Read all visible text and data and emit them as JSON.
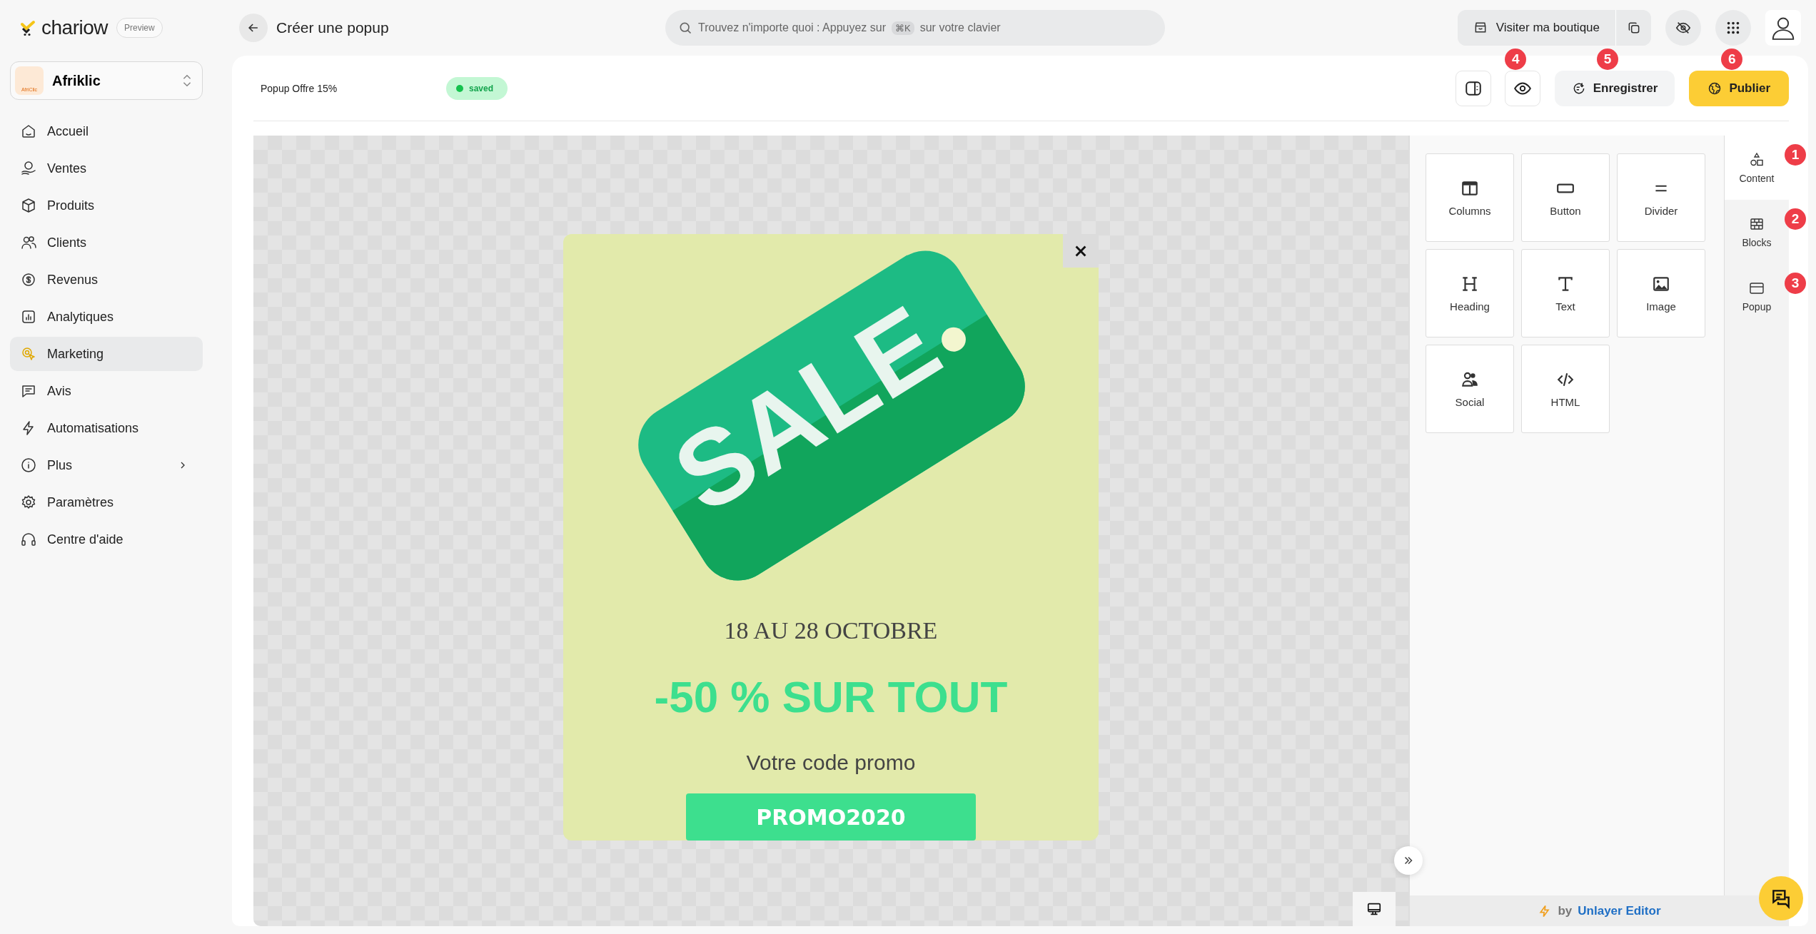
{
  "brand": {
    "name": "chariow",
    "badge": "Preview"
  },
  "store": {
    "name": "Afriklic",
    "logo_text": "AfriClic"
  },
  "nav": [
    {
      "label": "Accueil",
      "kind": "home",
      "selected": false,
      "expandable": false
    },
    {
      "label": "Ventes",
      "kind": "sales",
      "selected": false,
      "expandable": false
    },
    {
      "label": "Produits",
      "kind": "box",
      "selected": false,
      "expandable": false
    },
    {
      "label": "Clients",
      "kind": "users",
      "selected": false,
      "expandable": false
    },
    {
      "label": "Revenus",
      "kind": "revenue",
      "selected": false,
      "expandable": false
    },
    {
      "label": "Analytiques",
      "kind": "chart",
      "selected": false,
      "expandable": false
    },
    {
      "label": "Marketing",
      "kind": "marketing",
      "selected": true,
      "expandable": false
    },
    {
      "label": "Avis",
      "kind": "chat",
      "selected": false,
      "expandable": false
    },
    {
      "label": "Automatisations",
      "kind": "bolt",
      "selected": false,
      "expandable": false
    },
    {
      "label": "Plus",
      "kind": "info",
      "selected": false,
      "expandable": true
    },
    {
      "label": "Paramètres",
      "kind": "gear",
      "selected": false,
      "expandable": false
    },
    {
      "label": "Centre d'aide",
      "kind": "headset",
      "selected": false,
      "expandable": false
    }
  ],
  "topbar": {
    "title": "Créer une popup",
    "search": {
      "placeholder_before": "Trouvez n'importe quoi : Appuyez sur",
      "shortcut": "⌘K",
      "placeholder_after": "sur votre clavier"
    },
    "visit_button": "Visiter ma boutique"
  },
  "editor": {
    "name": "Popup Offre 15%",
    "status": {
      "label": "saved",
      "saved": true
    },
    "actions": [
      {
        "kind": "panel-toggle"
      },
      {
        "kind": "preview",
        "marker": "4"
      },
      {
        "kind": "save",
        "label": "Enregistrer",
        "marker": "5"
      },
      {
        "kind": "publish",
        "label": "Publier",
        "marker": "6"
      }
    ]
  },
  "popup": {
    "tag_text": "SALE",
    "date": "18 AU 28 OCTOBRE",
    "headline": "-50 % SUR TOUT",
    "subtitle": "Votre code promo",
    "code": "PROMO2020"
  },
  "tools": [
    {
      "label": "Columns",
      "kind": "columns"
    },
    {
      "label": "Button",
      "kind": "button"
    },
    {
      "label": "Divider",
      "kind": "divider"
    },
    {
      "label": "Heading",
      "kind": "heading"
    },
    {
      "label": "Text",
      "kind": "text"
    },
    {
      "label": "Image",
      "kind": "image"
    },
    {
      "label": "Social",
      "kind": "social"
    },
    {
      "label": "HTML",
      "kind": "html"
    }
  ],
  "tabs": [
    {
      "label": "Content",
      "kind": "shapes",
      "selected": true,
      "marker": "1"
    },
    {
      "label": "Blocks",
      "kind": "blocks",
      "selected": false,
      "marker": "2"
    },
    {
      "label": "Popup",
      "kind": "popup",
      "selected": false,
      "marker": "3"
    }
  ],
  "footer": {
    "by": "by",
    "editor": "Unlayer Editor"
  }
}
